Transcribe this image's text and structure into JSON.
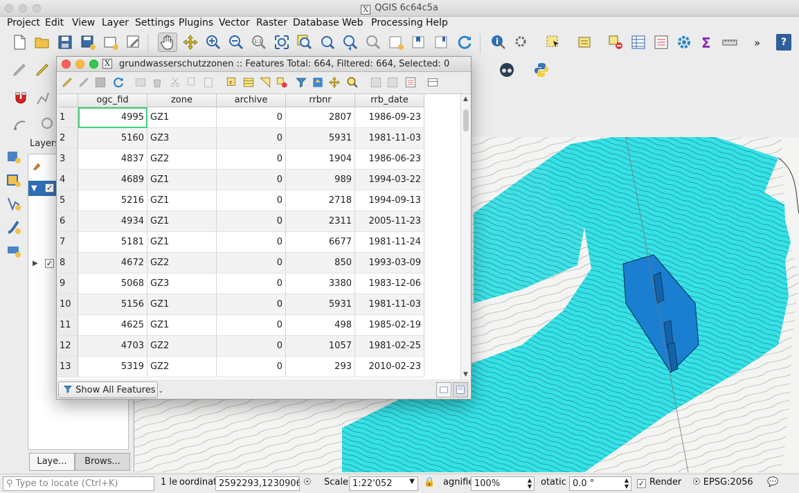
{
  "window": {
    "title": "QGIS 6c64c5a",
    "x_glyph": "X"
  },
  "menu": [
    "Project",
    "Edit",
    "View",
    "Layer",
    "Settings",
    "Plugins",
    "Vector",
    "Raster",
    "Database",
    "Web",
    "Processing",
    "Help"
  ],
  "toolbar": {
    "overflow": "»",
    "help": "?"
  },
  "layers_panel": {
    "title": "Layers",
    "tab_layers": "Laye...",
    "tab_browser": "Brows..."
  },
  "attribute_dialog": {
    "title": "grundwasserschutzzonen :: Features Total: 664, Filtered: 664, Selected: 0",
    "columns": [
      "ogc_fid",
      "zone",
      "archive",
      "rrbnr",
      "rrb_date"
    ],
    "rows": [
      {
        "n": "1",
        "ogc_fid": "4995",
        "zone": "GZ1",
        "archive": "0",
        "rrbnr": "2807",
        "rrb_date": "1986-09-23"
      },
      {
        "n": "2",
        "ogc_fid": "5160",
        "zone": "GZ3",
        "archive": "0",
        "rrbnr": "5931",
        "rrb_date": "1981-11-03"
      },
      {
        "n": "3",
        "ogc_fid": "4837",
        "zone": "GZ2",
        "archive": "0",
        "rrbnr": "1904",
        "rrb_date": "1986-06-23"
      },
      {
        "n": "4",
        "ogc_fid": "4689",
        "zone": "GZ1",
        "archive": "0",
        "rrbnr": "989",
        "rrb_date": "1994-03-22"
      },
      {
        "n": "5",
        "ogc_fid": "5216",
        "zone": "GZ1",
        "archive": "0",
        "rrbnr": "2718",
        "rrb_date": "1994-09-13"
      },
      {
        "n": "6",
        "ogc_fid": "4934",
        "zone": "GZ1",
        "archive": "0",
        "rrbnr": "2311",
        "rrb_date": "2005-11-23"
      },
      {
        "n": "7",
        "ogc_fid": "5181",
        "zone": "GZ1",
        "archive": "0",
        "rrbnr": "6677",
        "rrb_date": "1981-11-24"
      },
      {
        "n": "8",
        "ogc_fid": "4672",
        "zone": "GZ2",
        "archive": "0",
        "rrbnr": "850",
        "rrb_date": "1993-03-09"
      },
      {
        "n": "9",
        "ogc_fid": "5068",
        "zone": "GZ3",
        "archive": "0",
        "rrbnr": "3380",
        "rrb_date": "1983-12-06"
      },
      {
        "n": "10",
        "ogc_fid": "5156",
        "zone": "GZ1",
        "archive": "0",
        "rrbnr": "5931",
        "rrb_date": "1981-11-03"
      },
      {
        "n": "11",
        "ogc_fid": "4625",
        "zone": "GZ1",
        "archive": "0",
        "rrbnr": "498",
        "rrb_date": "1985-02-19"
      },
      {
        "n": "12",
        "ogc_fid": "4703",
        "zone": "GZ2",
        "archive": "0",
        "rrbnr": "1057",
        "rrb_date": "1981-02-25"
      },
      {
        "n": "13",
        "ogc_fid": "5319",
        "zone": "GZ2",
        "archive": "0",
        "rrbnr": "293",
        "rrb_date": "2010-02-23"
      }
    ],
    "show_all_button": "Show All Features"
  },
  "status_bar": {
    "locate_placeholder": "Type to locate (Ctrl+K)",
    "legend_text": "1 le",
    "coordinate_label": "oordinat",
    "coordinate_value": "2592293,1230906",
    "scale_label": "Scale",
    "scale_value": "1:22'052",
    "magnifier_label": "agnifie",
    "magnifier_value": "100%",
    "rotation_label": "otatic",
    "rotation_value": "0.0 °",
    "render_label": "Render",
    "crs": "EPSG:2056"
  },
  "colors": {
    "zone_fill": "#2ae0e6",
    "zone_inner": "#1a7fd1",
    "selection": "#3fd17a"
  }
}
